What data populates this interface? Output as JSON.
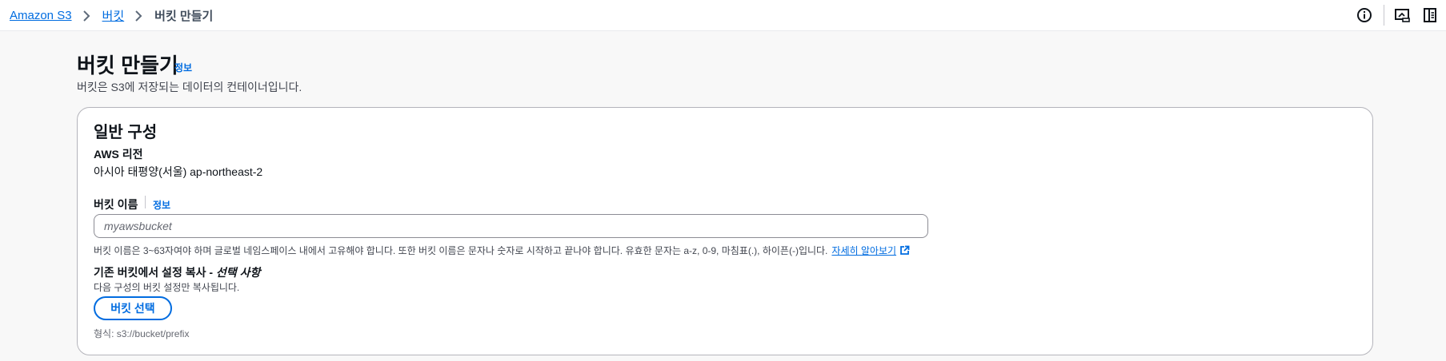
{
  "breadcrumb": {
    "items": [
      "Amazon S3",
      "버킷"
    ],
    "current": "버킷 만들기"
  },
  "topbar": {
    "icons": [
      "info-circle-icon",
      "preview-screen-icon",
      "side-panel-icon"
    ]
  },
  "page": {
    "title": "버킷 만들기",
    "info_label": "정보",
    "description": "버킷은 S3에 저장되는 데이터의 컨테이너입니다."
  },
  "general_config": {
    "heading": "일반 구성",
    "region_label": "AWS 리전",
    "region_value": "아시아 태평양(서울) ap-northeast-2",
    "bucket_name_label": "버킷 이름",
    "bucket_name_info": "정보",
    "bucket_name_value": "",
    "bucket_name_placeholder": "myawsbucket",
    "bucket_name_hint": "버킷 이름은 3~63자여야 하며 글로벌 네임스페이스 내에서 고유해야 합니다. 또한 버킷 이름은 문자나 숫자로 시작하고 끝나야 합니다. 유효한 문자는 a-z, 0-9, 마침표(.), 하이픈(-)입니다.",
    "learn_more": "자세히 알아보기",
    "copy_settings_title": "기존 버킷에서 설정 복사 -",
    "copy_settings_optional": "선택 사항",
    "copy_settings_desc": "다음 구성의 버킷 설정만 복사됩니다.",
    "choose_bucket_button": "버킷 선택",
    "format_hint": "형식: s3://bucket/prefix"
  },
  "colors": {
    "link": "#006ce0",
    "text": "#0f141a",
    "border": "#b4b4bb",
    "background": "#f8f8f8"
  }
}
